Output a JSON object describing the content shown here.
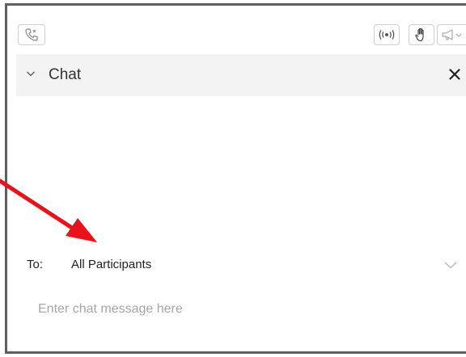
{
  "colors": {
    "panel_border": "#5f5f5f",
    "header_bg": "#f3f3f3",
    "text": "#333333",
    "placeholder": "#a6a6a6",
    "annotation_arrow": "#e8121b"
  },
  "toolbar": {
    "phone_icon": "phone-icon",
    "broadcast_icon": "broadcast-icon",
    "raise_hand_icon": "raise-hand-icon",
    "megaphone_icon": "megaphone-icon"
  },
  "chat": {
    "title": "Chat",
    "collapse_icon": "chevron-down-icon",
    "close_icon": "close-icon"
  },
  "recipient": {
    "label": "To:",
    "value": "All Participants",
    "dropdown_icon": "chevron-down-icon"
  },
  "message": {
    "placeholder": "Enter chat message here",
    "value": ""
  },
  "annotation": {
    "icon": "red-arrow-annotation"
  }
}
